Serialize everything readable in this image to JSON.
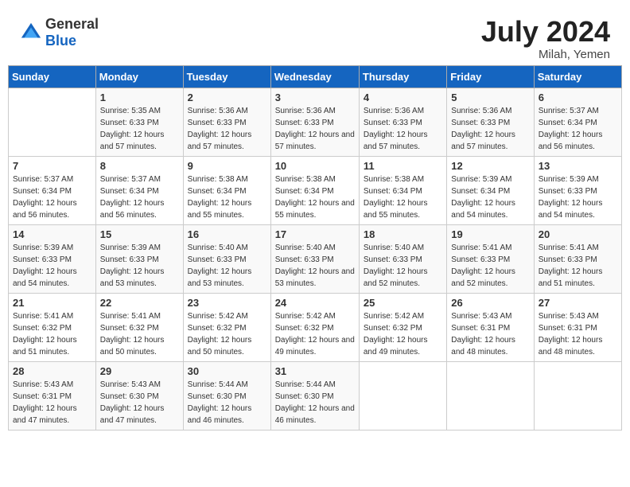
{
  "header": {
    "logo_general": "General",
    "logo_blue": "Blue",
    "month_year": "July 2024",
    "location": "Milah, Yemen"
  },
  "days_of_week": [
    "Sunday",
    "Monday",
    "Tuesday",
    "Wednesday",
    "Thursday",
    "Friday",
    "Saturday"
  ],
  "weeks": [
    [
      {
        "day": "",
        "sunrise": "",
        "sunset": "",
        "daylight": ""
      },
      {
        "day": "1",
        "sunrise": "Sunrise: 5:35 AM",
        "sunset": "Sunset: 6:33 PM",
        "daylight": "Daylight: 12 hours and 57 minutes."
      },
      {
        "day": "2",
        "sunrise": "Sunrise: 5:36 AM",
        "sunset": "Sunset: 6:33 PM",
        "daylight": "Daylight: 12 hours and 57 minutes."
      },
      {
        "day": "3",
        "sunrise": "Sunrise: 5:36 AM",
        "sunset": "Sunset: 6:33 PM",
        "daylight": "Daylight: 12 hours and 57 minutes."
      },
      {
        "day": "4",
        "sunrise": "Sunrise: 5:36 AM",
        "sunset": "Sunset: 6:33 PM",
        "daylight": "Daylight: 12 hours and 57 minutes."
      },
      {
        "day": "5",
        "sunrise": "Sunrise: 5:36 AM",
        "sunset": "Sunset: 6:33 PM",
        "daylight": "Daylight: 12 hours and 57 minutes."
      },
      {
        "day": "6",
        "sunrise": "Sunrise: 5:37 AM",
        "sunset": "Sunset: 6:34 PM",
        "daylight": "Daylight: 12 hours and 56 minutes."
      }
    ],
    [
      {
        "day": "7",
        "sunrise": "Sunrise: 5:37 AM",
        "sunset": "Sunset: 6:34 PM",
        "daylight": "Daylight: 12 hours and 56 minutes."
      },
      {
        "day": "8",
        "sunrise": "Sunrise: 5:37 AM",
        "sunset": "Sunset: 6:34 PM",
        "daylight": "Daylight: 12 hours and 56 minutes."
      },
      {
        "day": "9",
        "sunrise": "Sunrise: 5:38 AM",
        "sunset": "Sunset: 6:34 PM",
        "daylight": "Daylight: 12 hours and 55 minutes."
      },
      {
        "day": "10",
        "sunrise": "Sunrise: 5:38 AM",
        "sunset": "Sunset: 6:34 PM",
        "daylight": "Daylight: 12 hours and 55 minutes."
      },
      {
        "day": "11",
        "sunrise": "Sunrise: 5:38 AM",
        "sunset": "Sunset: 6:34 PM",
        "daylight": "Daylight: 12 hours and 55 minutes."
      },
      {
        "day": "12",
        "sunrise": "Sunrise: 5:39 AM",
        "sunset": "Sunset: 6:34 PM",
        "daylight": "Daylight: 12 hours and 54 minutes."
      },
      {
        "day": "13",
        "sunrise": "Sunrise: 5:39 AM",
        "sunset": "Sunset: 6:33 PM",
        "daylight": "Daylight: 12 hours and 54 minutes."
      }
    ],
    [
      {
        "day": "14",
        "sunrise": "Sunrise: 5:39 AM",
        "sunset": "Sunset: 6:33 PM",
        "daylight": "Daylight: 12 hours and 54 minutes."
      },
      {
        "day": "15",
        "sunrise": "Sunrise: 5:39 AM",
        "sunset": "Sunset: 6:33 PM",
        "daylight": "Daylight: 12 hours and 53 minutes."
      },
      {
        "day": "16",
        "sunrise": "Sunrise: 5:40 AM",
        "sunset": "Sunset: 6:33 PM",
        "daylight": "Daylight: 12 hours and 53 minutes."
      },
      {
        "day": "17",
        "sunrise": "Sunrise: 5:40 AM",
        "sunset": "Sunset: 6:33 PM",
        "daylight": "Daylight: 12 hours and 53 minutes."
      },
      {
        "day": "18",
        "sunrise": "Sunrise: 5:40 AM",
        "sunset": "Sunset: 6:33 PM",
        "daylight": "Daylight: 12 hours and 52 minutes."
      },
      {
        "day": "19",
        "sunrise": "Sunrise: 5:41 AM",
        "sunset": "Sunset: 6:33 PM",
        "daylight": "Daylight: 12 hours and 52 minutes."
      },
      {
        "day": "20",
        "sunrise": "Sunrise: 5:41 AM",
        "sunset": "Sunset: 6:33 PM",
        "daylight": "Daylight: 12 hours and 51 minutes."
      }
    ],
    [
      {
        "day": "21",
        "sunrise": "Sunrise: 5:41 AM",
        "sunset": "Sunset: 6:32 PM",
        "daylight": "Daylight: 12 hours and 51 minutes."
      },
      {
        "day": "22",
        "sunrise": "Sunrise: 5:41 AM",
        "sunset": "Sunset: 6:32 PM",
        "daylight": "Daylight: 12 hours and 50 minutes."
      },
      {
        "day": "23",
        "sunrise": "Sunrise: 5:42 AM",
        "sunset": "Sunset: 6:32 PM",
        "daylight": "Daylight: 12 hours and 50 minutes."
      },
      {
        "day": "24",
        "sunrise": "Sunrise: 5:42 AM",
        "sunset": "Sunset: 6:32 PM",
        "daylight": "Daylight: 12 hours and 49 minutes."
      },
      {
        "day": "25",
        "sunrise": "Sunrise: 5:42 AM",
        "sunset": "Sunset: 6:32 PM",
        "daylight": "Daylight: 12 hours and 49 minutes."
      },
      {
        "day": "26",
        "sunrise": "Sunrise: 5:43 AM",
        "sunset": "Sunset: 6:31 PM",
        "daylight": "Daylight: 12 hours and 48 minutes."
      },
      {
        "day": "27",
        "sunrise": "Sunrise: 5:43 AM",
        "sunset": "Sunset: 6:31 PM",
        "daylight": "Daylight: 12 hours and 48 minutes."
      }
    ],
    [
      {
        "day": "28",
        "sunrise": "Sunrise: 5:43 AM",
        "sunset": "Sunset: 6:31 PM",
        "daylight": "Daylight: 12 hours and 47 minutes."
      },
      {
        "day": "29",
        "sunrise": "Sunrise: 5:43 AM",
        "sunset": "Sunset: 6:30 PM",
        "daylight": "Daylight: 12 hours and 47 minutes."
      },
      {
        "day": "30",
        "sunrise": "Sunrise: 5:44 AM",
        "sunset": "Sunset: 6:30 PM",
        "daylight": "Daylight: 12 hours and 46 minutes."
      },
      {
        "day": "31",
        "sunrise": "Sunrise: 5:44 AM",
        "sunset": "Sunset: 6:30 PM",
        "daylight": "Daylight: 12 hours and 46 minutes."
      },
      {
        "day": "",
        "sunrise": "",
        "sunset": "",
        "daylight": ""
      },
      {
        "day": "",
        "sunrise": "",
        "sunset": "",
        "daylight": ""
      },
      {
        "day": "",
        "sunrise": "",
        "sunset": "",
        "daylight": ""
      }
    ]
  ]
}
